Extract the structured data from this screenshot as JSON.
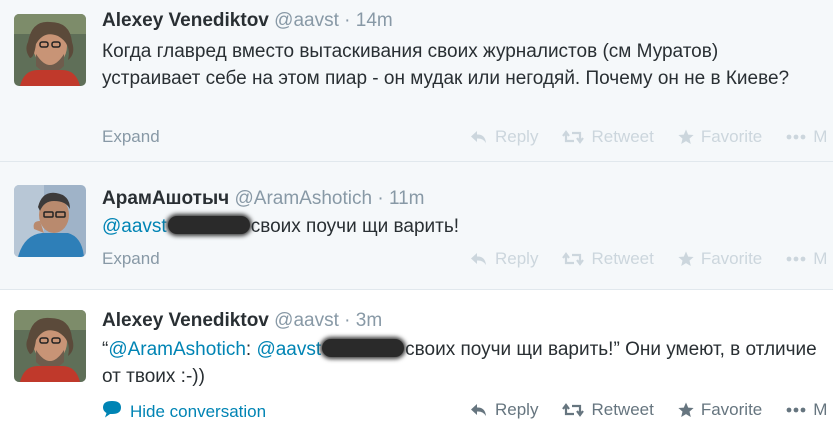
{
  "tweets": [
    {
      "name": "Alexey Venediktov",
      "handle": "@aavst",
      "sep": "·",
      "time": "14m",
      "text": "Когда главред вместо вытаскивания своих журналистов (см Муратов) устраивает себе на этом пиар - он мудак или негодяй. Почему он не в Киеве?",
      "expand": "Expand"
    },
    {
      "name": "АрамАшотыч",
      "handle": "@AramAshotich",
      "sep": "·",
      "time": "11m",
      "mention": "@aavst",
      "text_after": "своих поучи щи варить!",
      "expand": "Expand"
    },
    {
      "name": "Alexey Venediktov",
      "handle": "@aavst",
      "sep": "·",
      "time": "3m",
      "quote_open": "“",
      "mention1": "@AramAshotich",
      "colon": ":",
      "mention2": "@aavst",
      "text_after": "своих поучи щи варить!” Они умеют, в отличие от твоих :-))",
      "hide_conversation": "Hide conversation"
    }
  ],
  "actions": {
    "reply": "Reply",
    "retweet": "Retweet",
    "favorite": "Favorite",
    "more": "M"
  },
  "icons": [
    "reply-icon",
    "retweet-icon",
    "favorite-icon",
    "more-icon",
    "conversation-icon"
  ],
  "colors": {
    "link": "#0084b4",
    "muted": "#8899a6",
    "faded_action": "#ccd6dd",
    "action": "#66757f",
    "expanded_bg": "#f5f8fa"
  }
}
